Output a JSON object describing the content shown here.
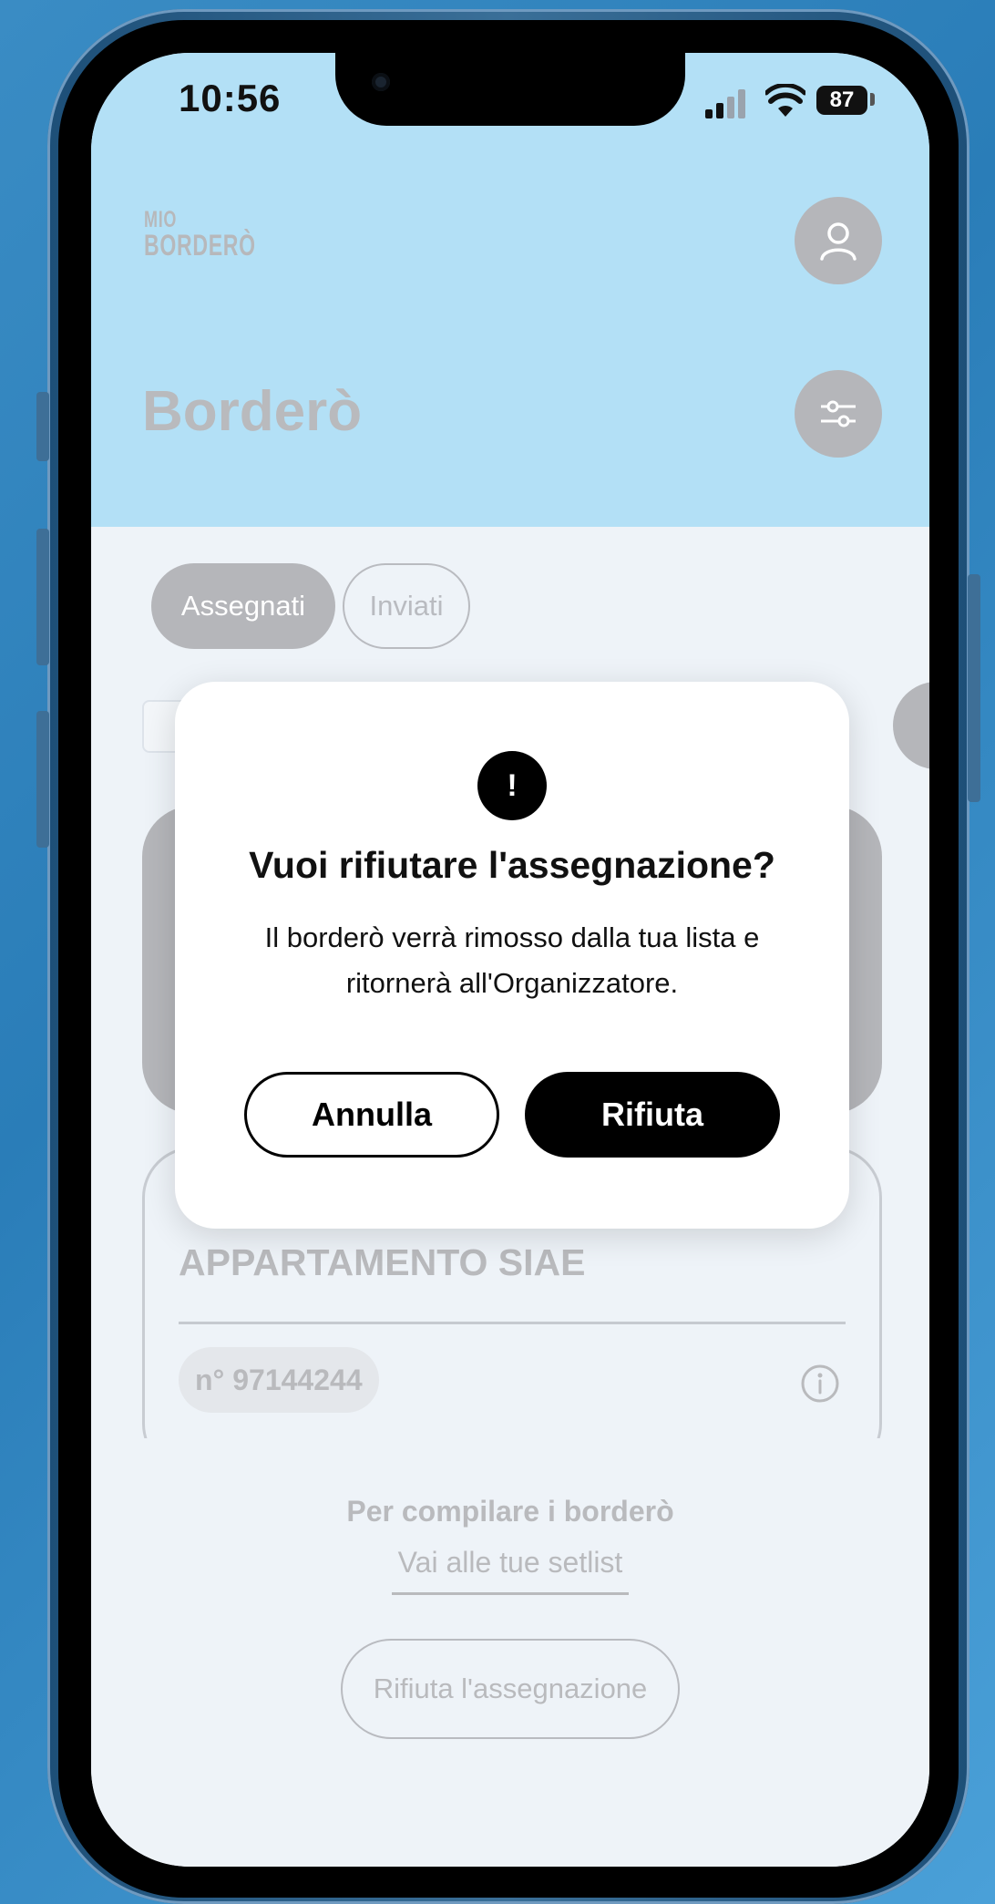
{
  "status_bar": {
    "time": "10:56",
    "battery": "87"
  },
  "header": {
    "logo_line1": "MIO",
    "logo_line2": "BORDERÒ",
    "title": "Borderò"
  },
  "tabs": [
    {
      "label": "Assegnati",
      "active": true
    },
    {
      "label": "Inviati",
      "active": false
    }
  ],
  "card": {
    "title": "APPARTAMENTO SIAE",
    "number": "n° 97144244"
  },
  "bottom": {
    "hint": "Per compilare i borderò",
    "link": "Vai alle tue setlist",
    "reject_button": "Rifiuta l'assegnazione"
  },
  "modal": {
    "icon": "!",
    "title": "Vuoi rifiutare l'assegnazione?",
    "body": "Il borderò verrà rimosso dalla tua lista e ritornerà all'Organizzatore.",
    "cancel_label": "Annulla",
    "confirm_label": "Rifiuta"
  },
  "icons": {
    "profile": "user-icon",
    "filter": "sliders-icon",
    "info": "info-icon"
  },
  "colors": {
    "header_bg": "#b3e0f6",
    "screen_bg": "#eef3f8",
    "muted_gray": "#b5b6ba",
    "primary": "#000000"
  }
}
